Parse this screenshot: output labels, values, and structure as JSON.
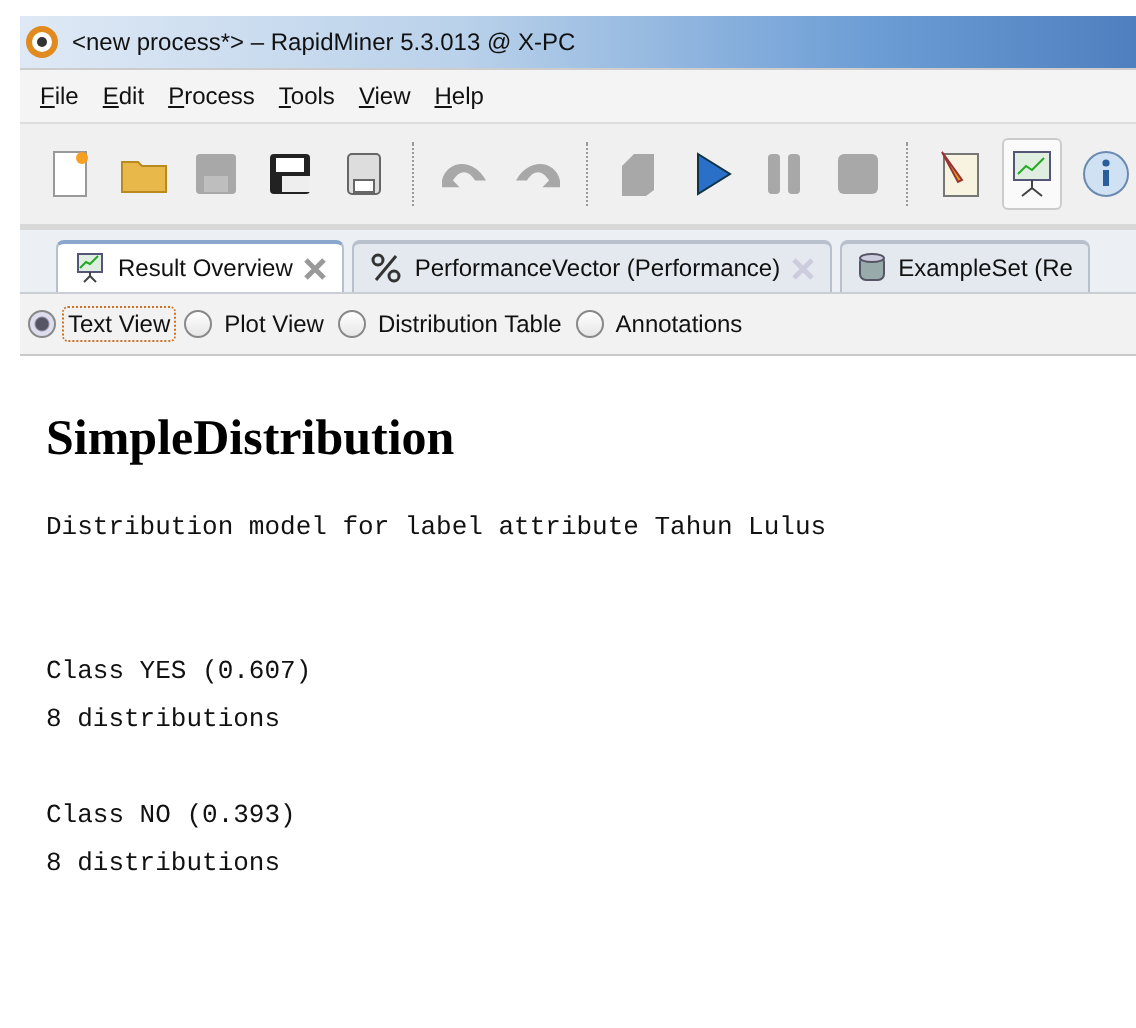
{
  "window": {
    "title": "<new process*> – RapidMiner 5.3.013 @ X-PC"
  },
  "menu": [
    "File",
    "Edit",
    "Process",
    "Tools",
    "View",
    "Help"
  ],
  "toolbar": [
    {
      "kind": "new",
      "disabled": false,
      "selected": false
    },
    {
      "kind": "open",
      "disabled": false,
      "selected": false
    },
    {
      "kind": "save",
      "disabled": true,
      "selected": false
    },
    {
      "kind": "saveas",
      "disabled": false,
      "selected": false
    },
    {
      "kind": "print",
      "disabled": false,
      "selected": false
    },
    {
      "kind": "sep"
    },
    {
      "kind": "undo",
      "disabled": true,
      "selected": false
    },
    {
      "kind": "redo",
      "disabled": true,
      "selected": false
    },
    {
      "kind": "sep"
    },
    {
      "kind": "operator",
      "disabled": true,
      "selected": false
    },
    {
      "kind": "run",
      "disabled": false,
      "selected": false
    },
    {
      "kind": "pause",
      "disabled": true,
      "selected": false
    },
    {
      "kind": "stop",
      "disabled": true,
      "selected": false
    },
    {
      "kind": "sep"
    },
    {
      "kind": "design",
      "disabled": false,
      "selected": false
    },
    {
      "kind": "results",
      "disabled": false,
      "selected": true
    },
    {
      "kind": "info",
      "disabled": false,
      "selected": false
    }
  ],
  "tabs": [
    {
      "label": "Result Overview",
      "kind": "chart",
      "closable": true,
      "selected": true
    },
    {
      "label": "PerformanceVector (Performance)",
      "kind": "percent",
      "closable": true,
      "selected": false
    },
    {
      "label": "ExampleSet (Re",
      "kind": "database",
      "closable": false,
      "selected": false
    }
  ],
  "views": [
    {
      "label": "Text View",
      "selected": true
    },
    {
      "label": "Plot View",
      "selected": false
    },
    {
      "label": "Distribution Table",
      "selected": false
    },
    {
      "label": "Annotations",
      "selected": false
    }
  ],
  "content": {
    "heading": "SimpleDistribution",
    "description": "Distribution model for label attribute Tahun Lulus",
    "classes": [
      {
        "label": "Class YES (0.607)",
        "detail": "8 distributions"
      },
      {
        "label": "Class NO (0.393)",
        "detail": "8 distributions"
      }
    ]
  }
}
